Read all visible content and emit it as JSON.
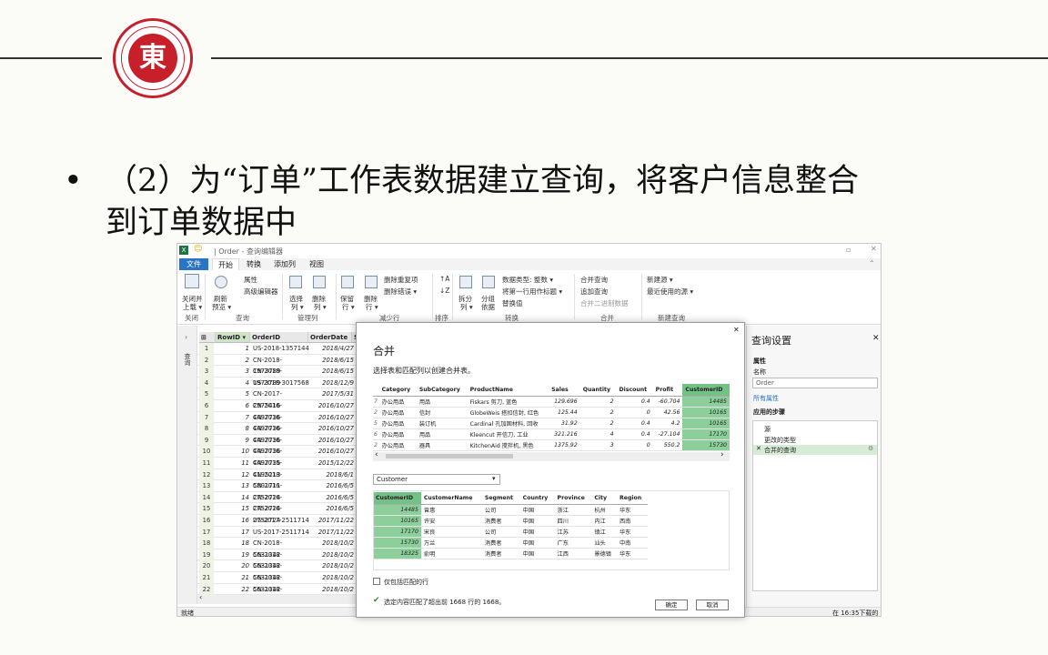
{
  "heading": {
    "bullet": "•",
    "line1": "（2）为“订单”工作表数据建立查询，将客户信息整合",
    "line2": "到订单数据中"
  },
  "app": {
    "title": "| Order - 查询编辑器",
    "tabs": [
      "文件",
      "开始",
      "转换",
      "添加列",
      "视图"
    ],
    "ribbon": {
      "close_load": "关闭并\n上载",
      "close_load_a": "关闭并",
      "close_load_b": "上载 ▾",
      "refresh_a": "刷新",
      "refresh_b": "预览 ▾",
      "properties": "属性",
      "advanced_editor": "高级编辑器",
      "choose_cols_a": "选择",
      "choose_cols_b": "列 ▾",
      "remove_cols_a": "删除",
      "remove_cols_b": "列 ▾",
      "keep_rows_a": "保留",
      "keep_rows_b": "行 ▾",
      "remove_rows_a": "删除",
      "remove_rows_b": "行 ▾",
      "remove_dup": "删除重复项",
      "remove_err": "删除错误 ▾",
      "split_a": "拆分",
      "split_b": "列 ▾",
      "group_a": "分组",
      "group_b": "依据",
      "datatype": "数据类型: 整数 ▾",
      "first_row": "将第一行用作标题 ▾",
      "replace": "替换值",
      "merge_q": "合并查询",
      "append_q": "追加查询",
      "combine_bin": "合并二进制数据",
      "new_source": "新建源 ▾",
      "recent_source": "最近使用的源 ▾",
      "groups": [
        "关闭",
        "查询",
        "管理列",
        "减少行",
        "排序",
        "转换",
        "合并",
        "新建查询"
      ]
    },
    "leftnav_label": "查询",
    "grid": {
      "headers": [
        "RowID",
        "OrderID",
        "OrderDate",
        "Sh"
      ],
      "rows": [
        [
          "1",
          "1",
          "US-2018-1357144",
          "2018/4/27"
        ],
        [
          "2",
          "2",
          "CN-2018-1973789",
          "2018/6/15"
        ],
        [
          "3",
          "3",
          "CN-2018-1973789",
          "2018/6/15"
        ],
        [
          "4",
          "4",
          "US-2018-3017568",
          "2018/12/9"
        ],
        [
          "5",
          "5",
          "CN-2017-2975416",
          "2017/5/31"
        ],
        [
          "6",
          "6",
          "CN-2016-4497736",
          "2016/10/27"
        ],
        [
          "7",
          "7",
          "CN-2016-4497736",
          "2016/10/27"
        ],
        [
          "8",
          "8",
          "CN-2016-4497736",
          "2016/10/27"
        ],
        [
          "9",
          "9",
          "CN-2016-4497736",
          "2016/10/27"
        ],
        [
          "10",
          "10",
          "CN-2016-4497736",
          "2016/10/27"
        ],
        [
          "11",
          "11",
          "CN-2015-4195213",
          "2015/12/22"
        ],
        [
          "12",
          "12",
          "CN-2018-5801711",
          "2018/6/1"
        ],
        [
          "13",
          "13",
          "CN-2016-2752724",
          "2016/6/5"
        ],
        [
          "14",
          "14",
          "CN-2016-2752724",
          "2016/6/5"
        ],
        [
          "15",
          "15",
          "CN-2016-2752724",
          "2016/6/5"
        ],
        [
          "16",
          "16",
          "US-2017-2511714",
          "2017/11/22"
        ],
        [
          "17",
          "17",
          "US-2017-2511714",
          "2017/11/22"
        ],
        [
          "18",
          "18",
          "CN-2018-5631342",
          "2018/10/2"
        ],
        [
          "19",
          "19",
          "CN-2018-5631342",
          "2018/10/2"
        ],
        [
          "20",
          "20",
          "CN-2018-5631342",
          "2018/10/2"
        ],
        [
          "21",
          "21",
          "CN-2018-5631342",
          "2018/10/2"
        ],
        [
          "22",
          "22",
          "CN-2018-5631342",
          "2018/10/2"
        ]
      ]
    },
    "status_left": "就绪",
    "status_right": "在 16:35下载的预",
    "query_settings": {
      "title": "查询设置",
      "properties": "属性",
      "name_label": "名称",
      "name_value": "Order",
      "all_props": "所有属性",
      "applied_steps": "应用的步骤",
      "steps": [
        "源",
        "更改的类型",
        "合并的查询"
      ]
    }
  },
  "dialog": {
    "title": "合并",
    "subtitle": "选择表和匹配列以创建合并表。",
    "top_headers": [
      "Category",
      "SubCategory",
      "ProductName",
      "Sales",
      "Quantity",
      "Discount",
      "Profit",
      "CustomerID"
    ],
    "top_rows": [
      [
        "7",
        "办公用品",
        "用品",
        "Fiskars 剪刀, 蓝色",
        "129.696",
        "2",
        "0.4",
        "-60.704",
        "14485"
      ],
      [
        "2",
        "办公用品",
        "信封",
        "GlobeWeis 搭扣信封, 红色",
        "125.44",
        "2",
        "0",
        "42.56",
        "10165"
      ],
      [
        "5",
        "办公用品",
        "装订机",
        "Cardinal 孔加固材料, 回收",
        "31.92",
        "2",
        "0.4",
        "4.2",
        "10165"
      ],
      [
        "6",
        "办公用品",
        "用品",
        "Kleencut 开信刀, 工业",
        "321.216",
        "4",
        "0.4",
        "-27.104",
        "17170"
      ],
      [
        "2",
        "办公用品",
        "器具",
        "KitchenAid 搅拌机, 黑色",
        "1375.92",
        "3",
        "0",
        "550.2",
        "15730"
      ]
    ],
    "select_value": "Customer",
    "bottom_headers": [
      "CustomerID",
      "CustomerName",
      "Segment",
      "Country",
      "Province",
      "City",
      "Region"
    ],
    "bottom_rows": [
      [
        "14485",
        "曾惠",
        "公司",
        "中国",
        "浙江",
        "杭州",
        "华东"
      ],
      [
        "10165",
        "许安",
        "消费者",
        "中国",
        "四川",
        "内江",
        "西南"
      ],
      [
        "17170",
        "宋良",
        "公司",
        "中国",
        "江苏",
        "镇江",
        "华东"
      ],
      [
        "15730",
        "万兰",
        "消费者",
        "中国",
        "广东",
        "汕头",
        "中南"
      ],
      [
        "18325",
        "俞明",
        "消费者",
        "中国",
        "江西",
        "景德镇",
        "华东"
      ]
    ],
    "only_matching": "仅包括匹配的行",
    "match_info": "选定内容匹配了超出前 1668 行的 1668。",
    "ok": "确定",
    "cancel": "取消"
  }
}
